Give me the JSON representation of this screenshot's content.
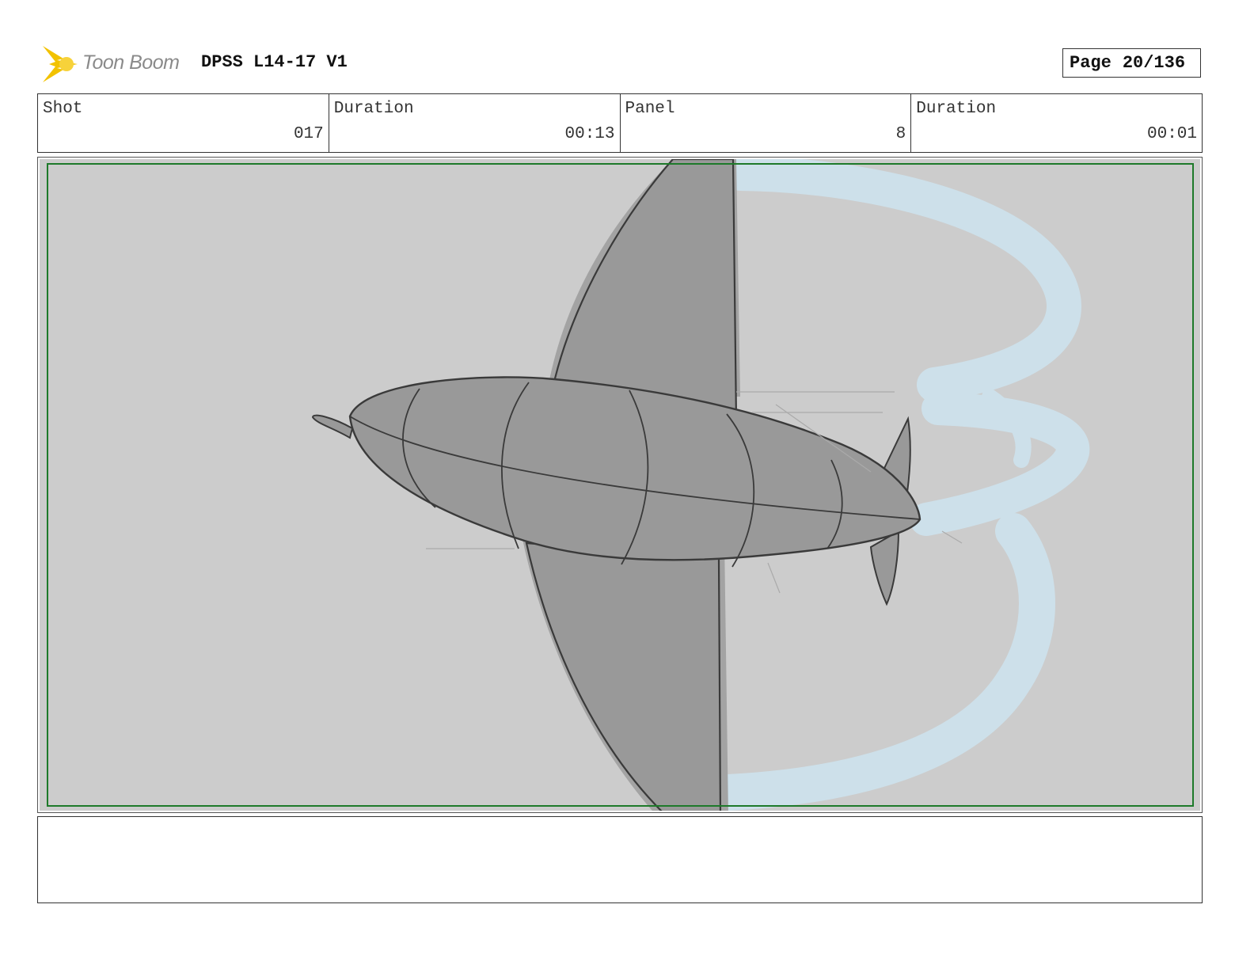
{
  "header": {
    "logo_text": "Toon Boom",
    "title": "DPSS L14-17 V1",
    "page_label": "Page",
    "page_number": "20/136"
  },
  "info": {
    "shot_label": "Shot",
    "shot_value": "017",
    "shot_duration_label": "Duration",
    "shot_duration_value": "00:13",
    "panel_label": "Panel",
    "panel_value": "8",
    "panel_duration_label": "Duration",
    "panel_duration_value": "00:01"
  },
  "colors": {
    "sky": "#cccccc",
    "plane": "#999999",
    "smoke": "#cde0ea",
    "safe_frame": "#1e7a2a",
    "logo_accent": "#f2c200"
  },
  "panel": {
    "drawing": "airplane-top-view-with-smoke-trail-icon"
  },
  "notes": {
    "text": ""
  }
}
